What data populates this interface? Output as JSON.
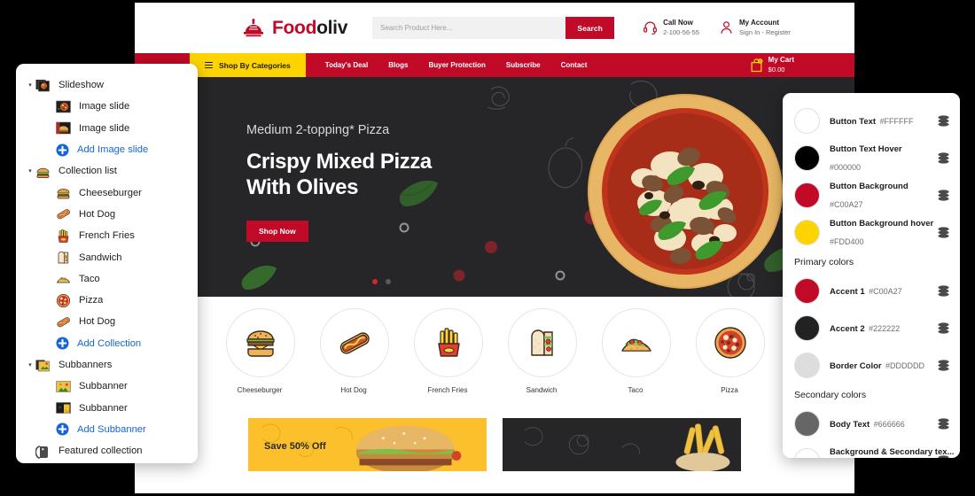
{
  "store": {
    "logo": {
      "brand_first": "Food",
      "brand_second": "oliv"
    },
    "search": {
      "placeholder": "Search Product Here...",
      "value": "",
      "button_label": "Search"
    },
    "header_info": [
      {
        "title": "Call Now",
        "subtitle": "2-100-56-55",
        "icon": "headset-icon"
      },
      {
        "title": "My Account",
        "subtitle": "Sign In - Register",
        "icon": "user-icon"
      }
    ],
    "nav": {
      "categories_label": "Shop By Categories",
      "links": [
        "Today's Deal",
        "Blogs",
        "Buyer Protection",
        "Subscribe",
        "Contact"
      ],
      "cart": {
        "title": "My Cart",
        "amount": "$0.00",
        "count": "0"
      }
    },
    "hero": {
      "subtitle": "Medium 2-topping* Pizza",
      "title_line1": "Crispy Mixed Pizza",
      "title_line2": "With Olives",
      "button_label": "Shop Now",
      "active_dot": 0,
      "dot_count": 2
    },
    "categories": [
      {
        "label": "Cheeseburger",
        "icon": "burger-icon"
      },
      {
        "label": "Hot Dog",
        "icon": "hotdog-icon"
      },
      {
        "label": "French Fries",
        "icon": "fries-icon"
      },
      {
        "label": "Sandwich",
        "icon": "sandwich-icon"
      },
      {
        "label": "Taco",
        "icon": "taco-icon"
      },
      {
        "label": "Pizza",
        "icon": "pizza-icon"
      }
    ],
    "subbanners": [
      {
        "text": "Save 50% Off",
        "style": "yellow"
      },
      {
        "text": "",
        "style": "dark"
      }
    ]
  },
  "sidebar": {
    "items": [
      {
        "label": "Slideshow",
        "level": 0,
        "icon": "slideshow-icon",
        "caret": "▾",
        "add": false
      },
      {
        "label": "Image slide",
        "level": 1,
        "icon": "pizza-thumb-icon",
        "caret": "",
        "add": false
      },
      {
        "label": "Image slide",
        "level": 1,
        "icon": "burger-thumb-icon",
        "caret": "",
        "add": false
      },
      {
        "label": "Add Image slide",
        "level": 1,
        "icon": "plus-icon",
        "caret": "",
        "add": true
      },
      {
        "label": "Collection list",
        "level": 0,
        "icon": "collection-icon",
        "caret": "▾",
        "add": false
      },
      {
        "label": "Cheeseburger",
        "level": 1,
        "icon": "burger-icon",
        "caret": "",
        "add": false
      },
      {
        "label": "Hot Dog",
        "level": 1,
        "icon": "hotdog-icon",
        "caret": "",
        "add": false
      },
      {
        "label": "French Fries",
        "level": 1,
        "icon": "fries-icon",
        "caret": "",
        "add": false
      },
      {
        "label": "Sandwich",
        "level": 1,
        "icon": "sandwich-icon",
        "caret": "",
        "add": false
      },
      {
        "label": "Taco",
        "level": 1,
        "icon": "taco-icon",
        "caret": "",
        "add": false
      },
      {
        "label": "Pizza",
        "level": 1,
        "icon": "pizza-icon",
        "caret": "",
        "add": false
      },
      {
        "label": "Hot Dog",
        "level": 1,
        "icon": "hotdog-icon",
        "caret": "",
        "add": false
      },
      {
        "label": "Add Collection",
        "level": 1,
        "icon": "plus-icon",
        "caret": "",
        "add": true
      },
      {
        "label": "Subbanners",
        "level": 0,
        "icon": "subbanner-icon",
        "caret": "▾",
        "add": false
      },
      {
        "label": "Subbanner",
        "level": 1,
        "icon": "sub-yellow-icon",
        "caret": "",
        "add": false
      },
      {
        "label": "Subbanner",
        "level": 1,
        "icon": "sub-dark-icon",
        "caret": "",
        "add": false
      },
      {
        "label": "Add Subbanner",
        "level": 1,
        "icon": "plus-icon",
        "caret": "",
        "add": true
      },
      {
        "label": "Featured collection",
        "level": 0,
        "icon": "featured-icon",
        "caret": "",
        "add": false
      }
    ]
  },
  "color_panel": {
    "rows": [
      {
        "kind": "color",
        "name": "Button Text",
        "hex": "#FFFFFF"
      },
      {
        "kind": "color",
        "name": "Button Text Hover",
        "hex": "#000000"
      },
      {
        "kind": "color",
        "name": "Button Background",
        "hex": "#C00A27"
      },
      {
        "kind": "color",
        "name": "Button Background hover",
        "hex": "#FDD400"
      },
      {
        "kind": "section",
        "name": "Primary colors",
        "hex": ""
      },
      {
        "kind": "color",
        "name": "Accent 1",
        "hex": "#C00A27"
      },
      {
        "kind": "color",
        "name": "Accent 2",
        "hex": "#222222"
      },
      {
        "kind": "color",
        "name": "Border Color",
        "hex": "#DDDDDD"
      },
      {
        "kind": "section",
        "name": "Secondary colors",
        "hex": ""
      },
      {
        "kind": "color",
        "name": "Body Text",
        "hex": "#666666"
      },
      {
        "kind": "color",
        "name": "Background & Secondary tex...",
        "hex": "#FFFFFF"
      }
    ]
  }
}
